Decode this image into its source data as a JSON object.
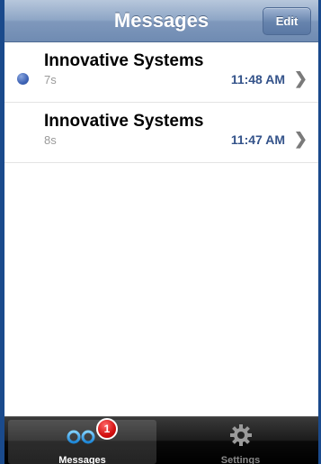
{
  "header": {
    "title": "Messages",
    "edit_label": "Edit"
  },
  "messages": [
    {
      "title": "Innovative Systems",
      "subtitle": "7s",
      "time": "11:48 AM",
      "unread": true
    },
    {
      "title": "Innovative Systems",
      "subtitle": "8s",
      "time": "11:47 AM",
      "unread": false
    }
  ],
  "tabbar": {
    "messages_label": "Messages",
    "messages_badge": "1",
    "settings_label": "Settings",
    "active_tab": "Messages"
  },
  "colors": {
    "accent": "#34538a",
    "unread_dot": "#3e63b5",
    "badge": "#d31010"
  },
  "icons": {
    "voicemail": "voicemail-icon",
    "settings": "gear-icon",
    "disclosure": "chevron-right-icon"
  }
}
